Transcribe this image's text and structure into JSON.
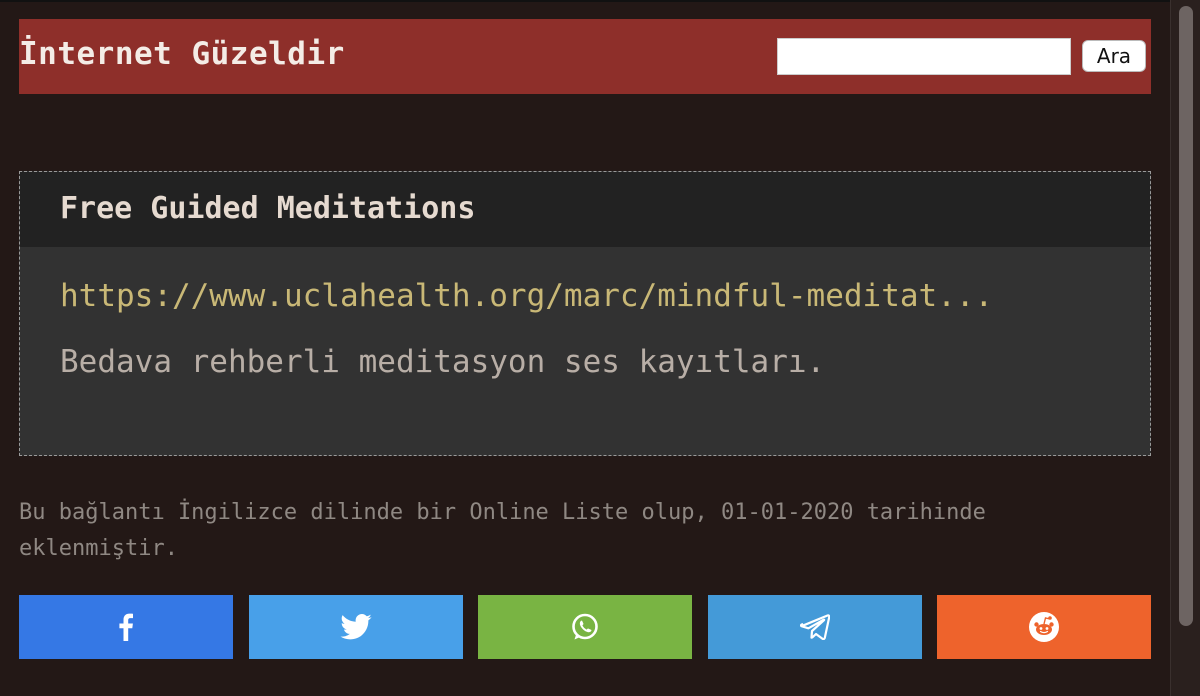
{
  "header": {
    "site_title": "İnternet Güzeldir",
    "search_placeholder": "",
    "search_value": "",
    "search_button_label": "Ara"
  },
  "card": {
    "title": "Free Guided Meditations",
    "link_text": "https://www.uclahealth.org/marc/mindful-meditat...",
    "description": "Bedava rehberli meditasyon ses kayıtları."
  },
  "meta": {
    "text": "Bu bağlantı İngilizce dilinde bir Online Liste olup, 01-01-2020 tarihinde eklenmiştir."
  },
  "share": [
    {
      "network": "facebook",
      "icon": "facebook-icon",
      "color": "#3578e5"
    },
    {
      "network": "twitter",
      "icon": "twitter-icon",
      "color": "#48a0e9"
    },
    {
      "network": "whatsapp",
      "icon": "whatsapp-icon",
      "color": "#79b443"
    },
    {
      "network": "telegram",
      "icon": "telegram-icon",
      "color": "#449ad8"
    },
    {
      "network": "reddit",
      "icon": "reddit-icon",
      "color": "#ee632c"
    }
  ],
  "colors": {
    "background": "#231816",
    "header": "#8e2f2a",
    "card": "#323232",
    "card_header": "#222222",
    "link": "#c9b876"
  }
}
